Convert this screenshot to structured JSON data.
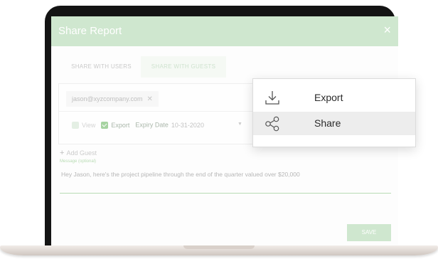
{
  "dialog": {
    "title": "Share Report",
    "close_glyph": "×"
  },
  "tabs": [
    {
      "label": "SHARE WITH USERS",
      "active": false
    },
    {
      "label": "SHARE WITH GUESTS",
      "active": true
    }
  ],
  "guest": {
    "email": "jason@xyzcompany.com",
    "remove_glyph": "✕",
    "permissions": {
      "view_label": "View",
      "view_checked": false,
      "export_label": "Export",
      "export_checked": true
    },
    "expiry_label": "Expiry Date",
    "expiry_value": "10-31-2020"
  },
  "add_guest_label": "Add Guest",
  "add_guest_glyph": "+",
  "message": {
    "label": "Message (optional)",
    "value": "Hey Jason, here's the project pipeline through the end of the quarter valued over $20,000"
  },
  "save_label": "SAVE",
  "popup_menu": {
    "items": [
      {
        "label": "Export",
        "icon": "download-icon"
      },
      {
        "label": "Share",
        "icon": "share-icon",
        "highlighted": true
      }
    ]
  },
  "colors": {
    "accent_green": "#cfe7cf",
    "checkbox_green": "#a6d3a1",
    "menu_highlight": "#ededed"
  }
}
